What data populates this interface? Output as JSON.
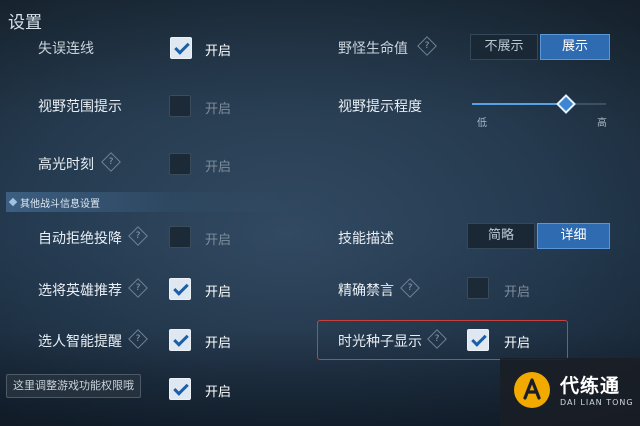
{
  "title": "设置",
  "rows": [
    {
      "name": "row-dropped-connection",
      "label": "失误连线",
      "checked": true,
      "state_label": "开启"
    },
    {
      "name": "row-vision-range-hint",
      "label": "视野范围提示",
      "checked": false,
      "state_label": "开启"
    },
    {
      "name": "row-highlight-moment",
      "label": "高光时刻",
      "help": true,
      "checked": false,
      "state_label": "开启"
    },
    {
      "name": "row-auto-reject-surrender",
      "label": "自动拒绝投降",
      "help": true,
      "checked": false,
      "state_label": "开启"
    },
    {
      "name": "row-hero-recommendation",
      "label": "选将英雄推荐",
      "help": true,
      "checked": true,
      "state_label": "开启"
    },
    {
      "name": "row-smart-pick-reminder",
      "label": "选人智能提醒",
      "help": true,
      "checked": true,
      "state_label": "开启"
    },
    {
      "name": "row-hidden-bottom",
      "label": "",
      "checked": true,
      "state_label": "开启"
    }
  ],
  "right_rows": {
    "toggle_top": {
      "label": "野怪生命值",
      "options": [
        "不展示",
        "展示"
      ],
      "selected": "展示"
    },
    "vision_hint_level": {
      "label": "视野提示程度",
      "min_label": "低",
      "max_label": "高",
      "value": 0.7
    },
    "skill_description": {
      "label": "技能描述",
      "options": [
        "简略",
        "详细"
      ],
      "selected": "详细"
    },
    "precise_mute": {
      "label": "精确禁言",
      "checked": false,
      "state_label": "开启"
    },
    "time_seed_display": {
      "label": "时光种子显示",
      "checked": true,
      "state_label": "开启"
    }
  },
  "section_label": "其他战斗信息设置",
  "tooltip": "这里调整游戏功能权限哦",
  "help_glyph": "?",
  "watermark": {
    "name": "代练通",
    "sub": "DAI LIAN TONG"
  },
  "colors": {
    "accent": "#2f6bb0",
    "highlight_box": "#c8403c"
  }
}
